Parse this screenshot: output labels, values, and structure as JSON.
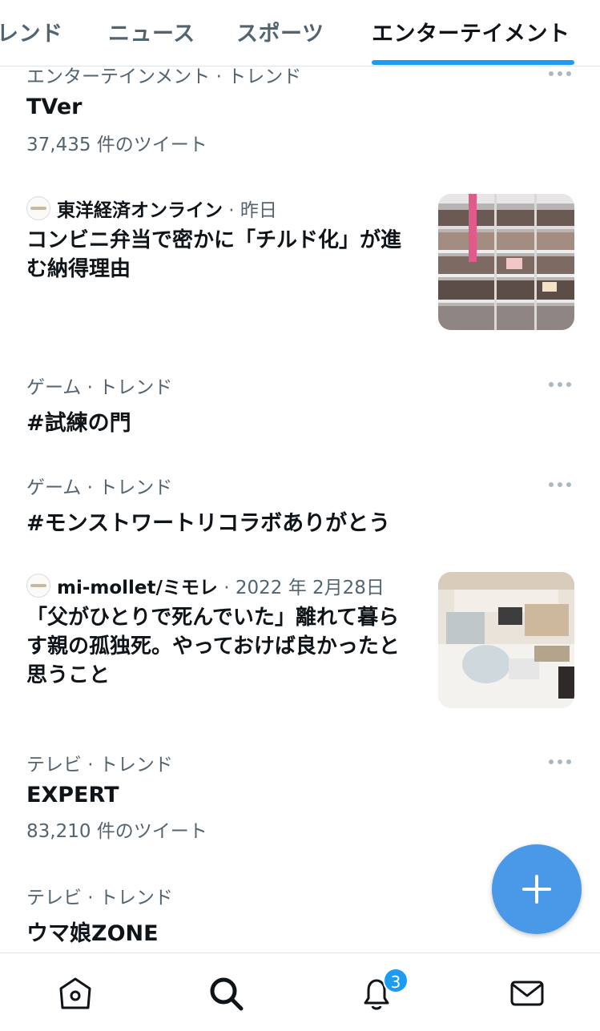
{
  "tabs": [
    {
      "label": "レンド"
    },
    {
      "label": "ニュース"
    },
    {
      "label": "スポーツ"
    },
    {
      "label": "エンターテイメント"
    }
  ],
  "feed": {
    "trend1": {
      "meta": "エンターテインメント · トレンド",
      "title": "TVer",
      "count": "37,435 件のツイート"
    },
    "news1": {
      "source": "東洋経済オンライン",
      "time": " · 昨日",
      "title": "コンビニ弁当で密かに「チルド化」が進む納得理由",
      "image": "convenience-store-shelves-photo"
    },
    "trend2": {
      "meta": "ゲーム · トレンド",
      "title": "#試練の門"
    },
    "trend3": {
      "meta": "ゲーム · トレンド",
      "title": "#モンストワートリコラボありがとう"
    },
    "news2": {
      "source": "mi-mollet/ミモレ",
      "time": " · 2022 年 2月28日",
      "title": "「父がひとりで死んでいた」離れて暮らす親の孤独死。やっておけば良かったと思うこと",
      "image": "living-room-interior-photo"
    },
    "trend4": {
      "meta": "テレビ · トレンド",
      "title": "EXPERT",
      "count": "83,210 件のツイート"
    },
    "trend5": {
      "meta": "テレビ · トレンド",
      "title": "ウマ娘ZONE"
    }
  },
  "fab": {
    "icon": "plus-icon"
  },
  "bottom_nav": {
    "items": [
      {
        "icon": "home-icon"
      },
      {
        "icon": "search-icon"
      },
      {
        "icon": "notifications-icon",
        "badge": "3"
      },
      {
        "icon": "messages-icon"
      }
    ]
  },
  "colors": {
    "accent": "#1d9bf0",
    "fab": "#4a99e9",
    "secondary_text": "#536471"
  }
}
